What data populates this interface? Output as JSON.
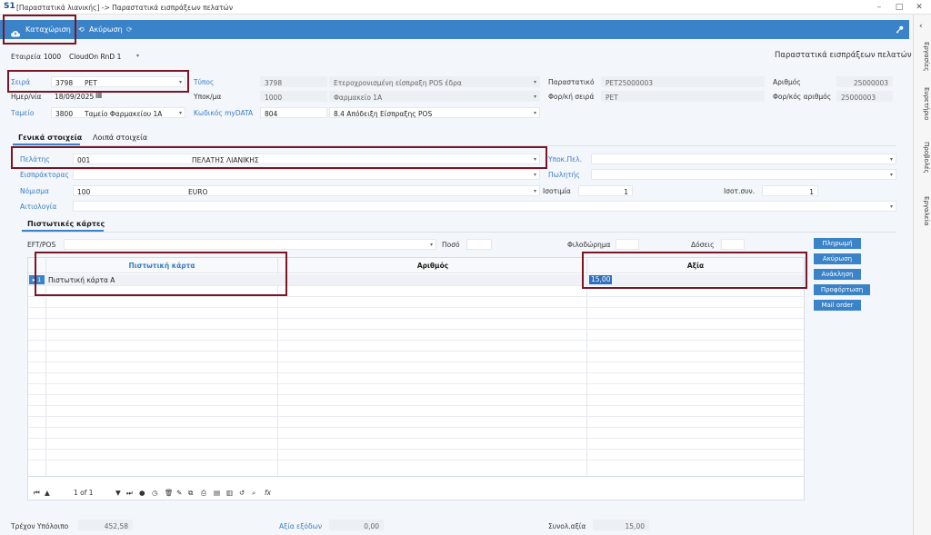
{
  "window": {
    "logo": "S1",
    "title": "[Παραστατικά λιανικής] -> Παραστατικά εισπράξεων πελατών",
    "controls": [
      "–",
      "□",
      "✕"
    ]
  },
  "toolbar": {
    "save_label": "Καταχώριση",
    "cancel_label": "Ακύρωση",
    "save_icon": "cloud-upload-icon",
    "cancel_icon": "undo-icon",
    "refresh_icon": "refresh-icon",
    "key_icon": "key-icon"
  },
  "side_panel": {
    "tabs": [
      "Εργασίες",
      "Ευρετήριο",
      "Προβολές",
      "Εργαλεία"
    ]
  },
  "header": {
    "company_label": "Εταιρεία",
    "company_code": "1000",
    "company_name": "CloudOn RnD 1",
    "form_title": "Παραστατικά εισπράξεων πελατών"
  },
  "fields": {
    "series": {
      "label": "Σειρά",
      "code": "3798",
      "name": "PET"
    },
    "date": {
      "label": "Ημερ/νία",
      "value": "18/09/2025"
    },
    "cashbox": {
      "label": "Ταμείο",
      "code": "3800",
      "name": "Ταμείο Φαρμακείου 1Α"
    },
    "type": {
      "label": "Τύπος",
      "code": "3798",
      "name": "Ετεροχρονισμένη είσπραξη POS έδρα"
    },
    "branch": {
      "label": "Υποκ/μα",
      "code": "1000",
      "name": "Φαρμακείο 1Α"
    },
    "mydata": {
      "label": "Κωδικός myDATA",
      "code": "804",
      "name": "8.4 Απόδειξη Είσπραξης POS"
    },
    "document": {
      "label": "Παραστατικό",
      "value": "PET25000003"
    },
    "tax_series": {
      "label": "Φορ/κή σειρά",
      "value": "PET"
    },
    "number": {
      "label": "Αριθμός",
      "value": "25000003"
    },
    "tax_number": {
      "label": "Φορ/κός αριθμός",
      "value": "25000003"
    }
  },
  "tabs": {
    "general": "Γενικά στοιχεία",
    "other": "Λοιπά στοιχεία"
  },
  "general": {
    "customer": {
      "label": "Πελάτης",
      "code": "001",
      "name": "ΠΕΛΑΤΗΣ ΛΙΑΝΙΚΗΣ"
    },
    "collector": {
      "label": "Εισπράκτορας"
    },
    "currency": {
      "label": "Νόμισμα",
      "code": "100",
      "name": "EURO"
    },
    "reason": {
      "label": "Αιτιολογία"
    },
    "customer_branch": {
      "label": "Υποκ.Πελ."
    },
    "seller": {
      "label": "Πωλητής"
    },
    "parity": {
      "label": "Ισοτιμία",
      "value": "1"
    },
    "parity_coef": {
      "label": "Ισοτ.συν.",
      "value": "1"
    }
  },
  "cards_tab": {
    "label": "Πιστωτικές κάρτες"
  },
  "cards": {
    "eft_label": "EFT/POS",
    "amount_label": "Ποσό",
    "tip_label": "Φιλοδώρημα",
    "installments_label": "Δόσεις",
    "columns": [
      "Πιστωτική κάρτα",
      "Αριθμός",
      "Αξία"
    ],
    "rows": [
      {
        "index": "1",
        "card": "Πιστωτική κάρτα Α",
        "number": "",
        "value": "15,00"
      }
    ],
    "buttons": [
      "Πληρωμή",
      "Ακύρωση",
      "Ανάκληση",
      "Προφόρτωση",
      "Mail order"
    ],
    "pager": "1 of 1"
  },
  "footer": {
    "balance_label": "Τρέχον Υπόλοιπο",
    "balance_value": "452,58",
    "expenses_label": "Αξία εξόδων",
    "expenses_value": "0,00",
    "total_label": "Συνολ.αξία",
    "total_value": "15,00"
  }
}
